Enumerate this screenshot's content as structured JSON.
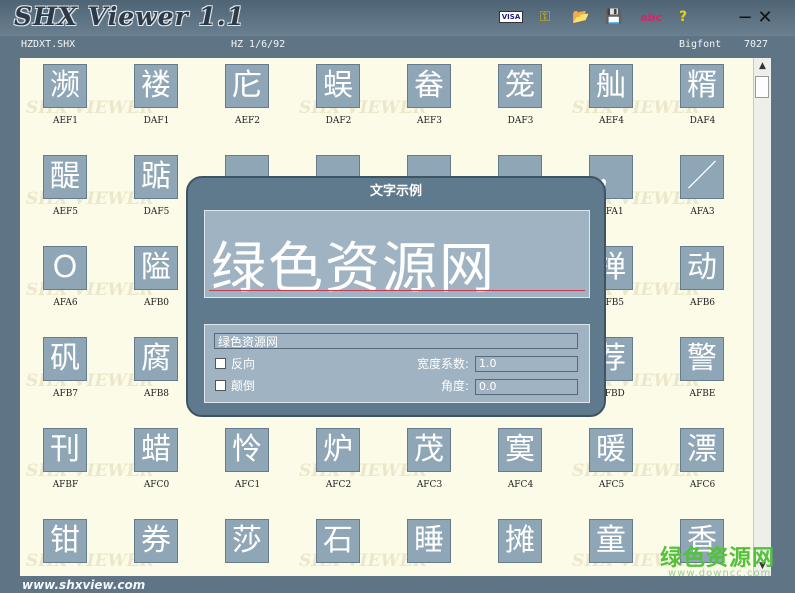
{
  "title_bar": {
    "app_title": "SHX Viewer 1.1",
    "toolbar": [
      {
        "name": "visa-icon",
        "glyph": "VISA"
      },
      {
        "name": "key-icon",
        "glyph": "⚿"
      },
      {
        "name": "open-folder-icon",
        "glyph": "📂"
      },
      {
        "name": "save-icon",
        "glyph": "💾"
      },
      {
        "name": "abc-icon",
        "glyph": "abc"
      },
      {
        "name": "help-icon",
        "glyph": "?"
      }
    ],
    "minimize": "−",
    "close": "✕"
  },
  "info_bar": {
    "file": "HZDXT.SHX",
    "font_info": "HZ 1/6/92",
    "font_type": "Bigfont",
    "count": "7027"
  },
  "watermark_text": "SHX VIEWER",
  "grid": [
    [
      {
        "glyph": "濒",
        "code": "AEF1"
      },
      {
        "glyph": "褛",
        "code": "DAF1"
      },
      {
        "glyph": "庀",
        "code": "AEF2"
      },
      {
        "glyph": "蜈",
        "code": "DAF2"
      },
      {
        "glyph": "畚",
        "code": "AEF3"
      },
      {
        "glyph": "笼",
        "code": "DAF3"
      },
      {
        "glyph": "舢",
        "code": "AEF4"
      },
      {
        "glyph": "糈",
        "code": "DAF4"
      }
    ],
    [
      {
        "glyph": "醍",
        "code": "AEF5"
      },
      {
        "glyph": "踮",
        "code": "DAF5"
      },
      {
        "glyph": "",
        "code": ""
      },
      {
        "glyph": "",
        "code": ""
      },
      {
        "glyph": "",
        "code": ""
      },
      {
        "glyph": "",
        "code": ""
      },
      {
        "glyph": "，",
        "code": "AFA1"
      },
      {
        "glyph": "／",
        "code": "AFA3"
      }
    ],
    [
      {
        "glyph": "Ｏ",
        "code": "AFA6"
      },
      {
        "glyph": "隘",
        "code": "AFB0"
      },
      {
        "glyph": "",
        "code": ""
      },
      {
        "glyph": "",
        "code": ""
      },
      {
        "glyph": "",
        "code": ""
      },
      {
        "glyph": "",
        "code": ""
      },
      {
        "glyph": "掸",
        "code": "AFB5"
      },
      {
        "glyph": "动",
        "code": "AFB6"
      }
    ],
    [
      {
        "glyph": "矾",
        "code": "AFB7"
      },
      {
        "glyph": "腐",
        "code": "AFB8"
      },
      {
        "glyph": "",
        "code": ""
      },
      {
        "glyph": "",
        "code": ""
      },
      {
        "glyph": "",
        "code": ""
      },
      {
        "glyph": "",
        "code": ""
      },
      {
        "glyph": "荐",
        "code": "AFBD"
      },
      {
        "glyph": "警",
        "code": "AFBE"
      }
    ],
    [
      {
        "glyph": "刊",
        "code": "AFBF"
      },
      {
        "glyph": "蜡",
        "code": "AFC0"
      },
      {
        "glyph": "怜",
        "code": "AFC1"
      },
      {
        "glyph": "炉",
        "code": "AFC2"
      },
      {
        "glyph": "茂",
        "code": "AFC3"
      },
      {
        "glyph": "寞",
        "code": "AFC4"
      },
      {
        "glyph": "暖",
        "code": "AFC5"
      },
      {
        "glyph": "漂",
        "code": "AFC6"
      }
    ],
    [
      {
        "glyph": "钳",
        "code": ""
      },
      {
        "glyph": "券",
        "code": ""
      },
      {
        "glyph": "莎",
        "code": ""
      },
      {
        "glyph": "石",
        "code": ""
      },
      {
        "glyph": "睡",
        "code": ""
      },
      {
        "glyph": "摊",
        "code": ""
      },
      {
        "glyph": "童",
        "code": ""
      },
      {
        "glyph": "香",
        "code": ""
      }
    ]
  ],
  "dialog": {
    "title": "文字示例",
    "preview_text": "绿色资源网",
    "sample_input": "绿色资源网",
    "reverse_label": "反向",
    "reverse_checked": false,
    "invert_label": "颠倒",
    "invert_checked": false,
    "width_factor_label": "宽度系数:",
    "width_factor_value": "1.0",
    "angle_label": "角度:",
    "angle_value": "0.0"
  },
  "footer": {
    "url": "www.shxview.com",
    "brand": "绿色资源网",
    "brand_sub": "www.downcc.com"
  },
  "colors": {
    "frame": "#5f7586",
    "content_bg": "#fbfbe8",
    "glyph_box": "#8fa6b7",
    "brand_green": "#53c13a",
    "baseline_red": "#c53b4f"
  }
}
